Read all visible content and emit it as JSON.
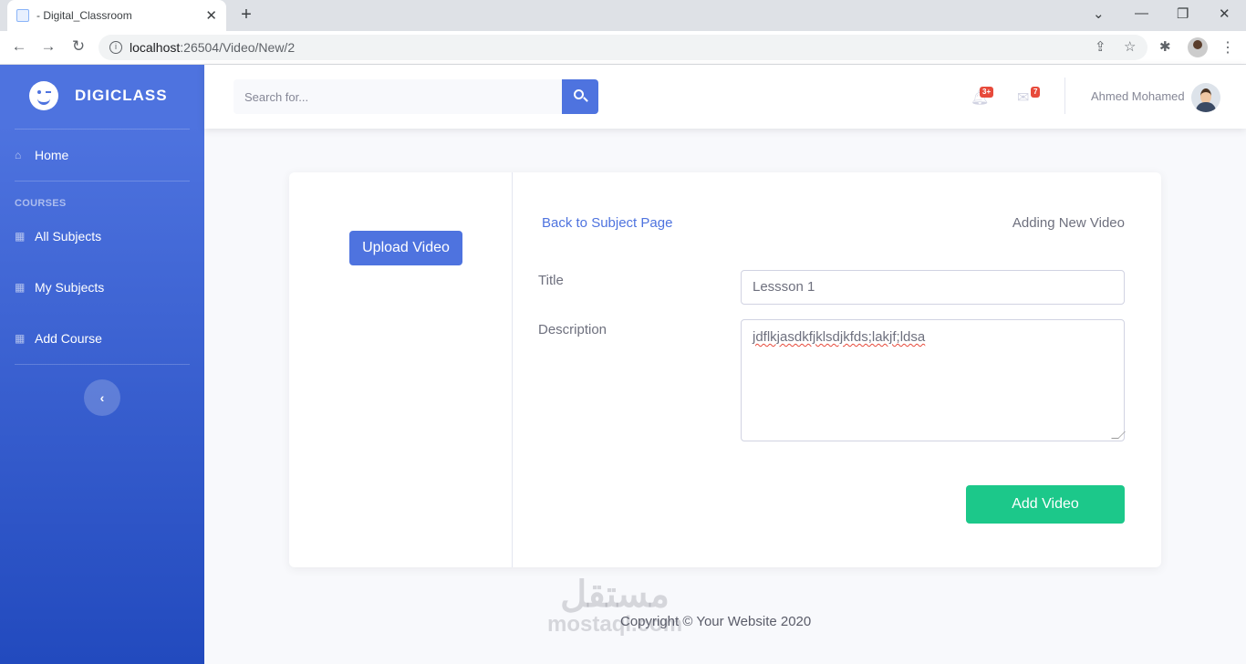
{
  "browser": {
    "tab_title": "- Digital_Classroom",
    "tab_close": "✕",
    "new_tab": "+",
    "url_host": "localhost",
    "url_path": ":26504/Video/New/2",
    "icons": [
      "back-arrow-icon",
      "forward-arrow-icon",
      "reload-icon",
      "info-icon",
      "share-icon",
      "star-icon",
      "puzzle-icon",
      "kebab-menu-icon"
    ]
  },
  "sidebar": {
    "brand": "DIGICLASS",
    "items": [
      {
        "label": "Home",
        "icon": "home-icon"
      },
      {
        "label": "All Subjects",
        "icon": "cubes-icon"
      },
      {
        "label": "My Subjects",
        "icon": "cubes-icon"
      },
      {
        "label": "Add Course",
        "icon": "cubes-icon"
      }
    ],
    "heading": "COURSES",
    "toggle": "‹"
  },
  "topbar": {
    "search_placeholder": "Search for...",
    "alerts_badge": "3+",
    "messages_badge": "7",
    "user_name": "Ahmed Mohamed"
  },
  "card": {
    "upload_label": "Upload Video",
    "back_link": "Back to Subject Page",
    "heading": "Adding New Video",
    "title_label": "Title",
    "title_value": "Lessson 1",
    "description_label": "Description",
    "description_value": "jdflkjasdkfjklsdjkfds;lakjf;ldsa",
    "submit_label": "Add Video"
  },
  "footer": {
    "copyright": "Copyright © Your Website 2020"
  },
  "watermark": {
    "arabic": "مستقل",
    "latin": "mostaql.com"
  },
  "colors": {
    "primary": "#4e73df",
    "success": "#1cc88a",
    "danger": "#e74a3b"
  }
}
